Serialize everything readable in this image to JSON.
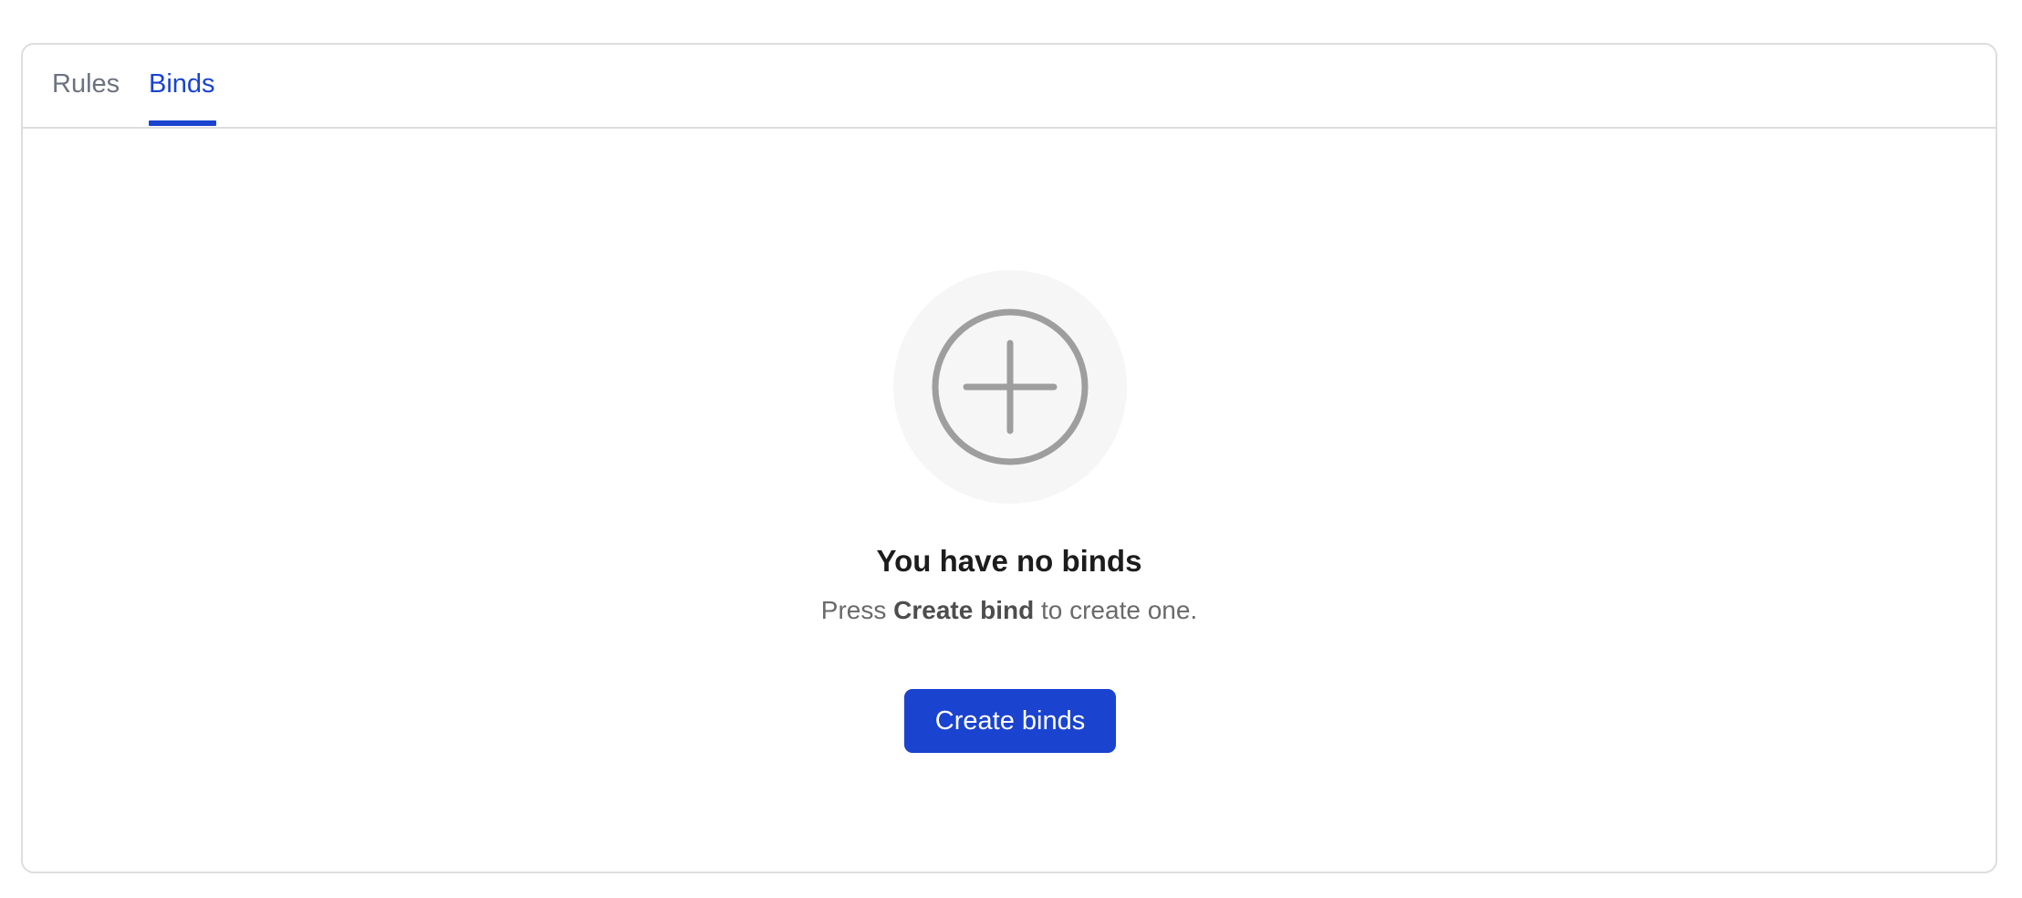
{
  "tabs": [
    {
      "label": "Rules",
      "active": false
    },
    {
      "label": "Binds",
      "active": true
    }
  ],
  "empty_state": {
    "icon": "plus-circle-icon",
    "title": "You have no binds",
    "description_prefix": "Press ",
    "description_emphasis": "Create bind",
    "description_suffix": " to create one.",
    "button_label": "Create binds"
  },
  "colors": {
    "accent": "#1a43d0",
    "inactive_tab": "#6c7280",
    "icon_stroke": "#9e9e9e",
    "icon_bg": "#f6f6f6"
  }
}
